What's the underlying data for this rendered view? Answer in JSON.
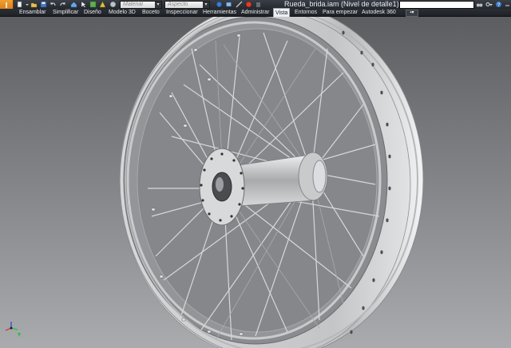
{
  "app": {
    "logo_letter": "I"
  },
  "quick_access": {
    "material_placeholder": "Material",
    "appearance_placeholder": "Aspecto",
    "document_title": "Rueda_brida.iam (Nivel de detalle1)"
  },
  "ribbon": {
    "tabs": [
      {
        "label": "Ensamblar",
        "active": false
      },
      {
        "label": "Simplificar",
        "active": false
      },
      {
        "label": "Diseño",
        "active": false
      },
      {
        "label": "Modelo 3D",
        "active": false
      },
      {
        "label": "Boceto",
        "active": false
      },
      {
        "label": "Inspeccionar",
        "active": false
      },
      {
        "label": "Herramientas",
        "active": false
      },
      {
        "label": "Administrar",
        "active": false
      },
      {
        "label": "Vista",
        "active": true
      },
      {
        "label": "Entornos",
        "active": false
      },
      {
        "label": "Para empezar",
        "active": false
      },
      {
        "label": "Autodesk 360",
        "active": false
      }
    ],
    "tab_menu_glyph": "▪▾"
  },
  "icons": {
    "qat": [
      "new-icon",
      "open-icon",
      "save-icon",
      "undo-icon",
      "redo-icon",
      "home-icon",
      "select-icon",
      "properties-icon",
      "color-sphere-icon"
    ],
    "right": [
      "binoculars-icon",
      "key-icon",
      "help-icon",
      "minimize-icon"
    ],
    "triad": "view-cube-triad-icon"
  },
  "colors": {
    "app_button": "#e8891c",
    "ribbon_bg": "#24282e",
    "active_tab_bg": "#eef1f4",
    "viewport_top": "#5b5d60",
    "viewport_bottom": "#a9abae",
    "rim": "#c7c9cb"
  }
}
